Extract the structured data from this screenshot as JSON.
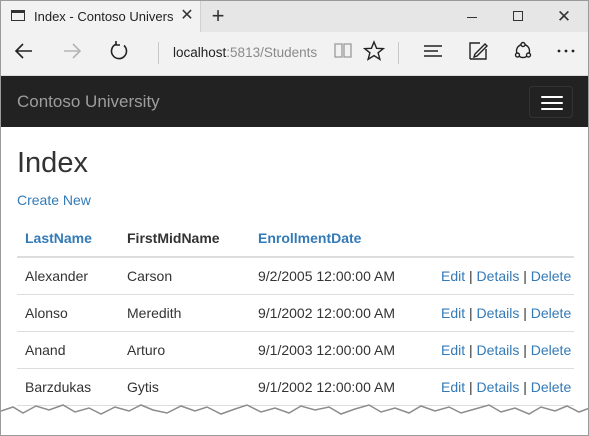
{
  "browser": {
    "tab_title": "Index - Contoso Univers",
    "tab_close": "✕",
    "new_tab": "+",
    "window_close": "✕",
    "address_host": "localhost",
    "address_rest": ":5813/Students"
  },
  "site": {
    "brand": "Contoso University"
  },
  "page": {
    "title": "Index",
    "create_new": "Create New"
  },
  "table": {
    "headers": [
      "LastName",
      "FirstMidName",
      "EnrollmentDate"
    ],
    "rows": [
      {
        "last": "Alexander",
        "first": "Carson",
        "date": "9/2/2005 12:00:00 AM"
      },
      {
        "last": "Alonso",
        "first": "Meredith",
        "date": "9/1/2002 12:00:00 AM"
      },
      {
        "last": "Anand",
        "first": "Arturo",
        "date": "9/1/2003 12:00:00 AM"
      },
      {
        "last": "Barzdukas",
        "first": "Gytis",
        "date": "9/1/2002 12:00:00 AM"
      }
    ],
    "actions": {
      "edit": "Edit",
      "details": "Details",
      "delete": "Delete",
      "separator": "|"
    }
  },
  "colors": {
    "link": "#337ab7",
    "navbar": "#222222"
  }
}
